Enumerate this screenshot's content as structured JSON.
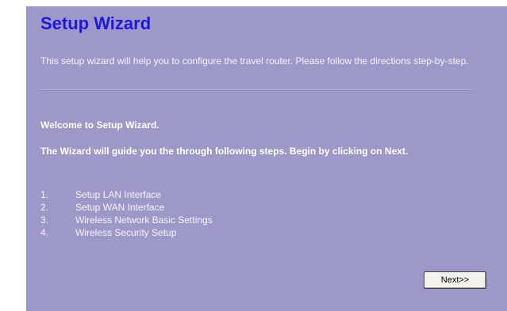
{
  "wizard": {
    "title": "Setup Wizard",
    "intro": "This setup wizard will help you to configure the travel router. Please follow the directions step-by-step.",
    "welcome": "Welcome to Setup Wizard.",
    "guide": "The Wizard will guide you the through following steps. Begin by clicking on Next.",
    "steps": [
      {
        "number": "1.",
        "label": "Setup LAN Interface"
      },
      {
        "number": "2.",
        "label": "Setup WAN Interface"
      },
      {
        "number": "3.",
        "label": "Wireless Network Basic Settings"
      },
      {
        "number": "4.",
        "label": "Wireless Security Setup"
      }
    ],
    "next_label": "Next>>"
  },
  "colors": {
    "panel_background": "#9c99c8",
    "title": "#1f16e0",
    "text": "#ffffff"
  }
}
